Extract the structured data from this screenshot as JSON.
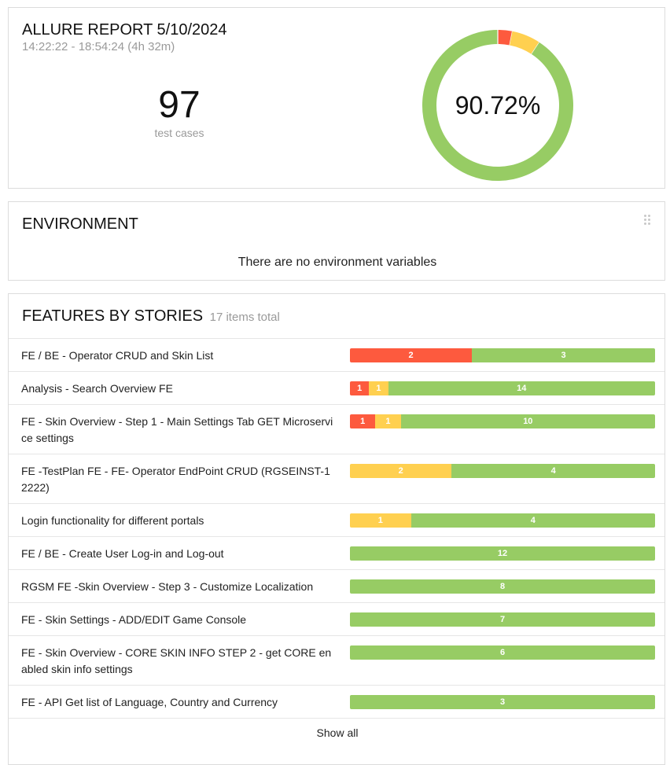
{
  "summary": {
    "title": "ALLURE REPORT 5/10/2024",
    "time_range": "14:22:22 - 18:54:24 (4h 32m)",
    "total": "97",
    "total_label": "test cases",
    "pass_rate": "90.72%",
    "donut": {
      "failed": 3,
      "broken": 6,
      "passed": 88,
      "colors": {
        "failed": "#fd5a3e",
        "broken": "#ffd050",
        "passed": "#97cc64"
      }
    }
  },
  "environment": {
    "title": "ENVIRONMENT",
    "empty_message": "There are no environment variables",
    "handle_icon": "drag-handle-icon"
  },
  "features": {
    "title": "FEATURES BY STORIES",
    "subtitle": "17 items total",
    "show_all_label": "Show all",
    "rows": [
      {
        "label": "FE / BE - Operator CRUD and Skin List",
        "failed": 2,
        "broken": 0,
        "passed": 3
      },
      {
        "label": "Analysis - Search Overview FE",
        "failed": 1,
        "broken": 1,
        "passed": 14
      },
      {
        "label": "FE - Skin Overview - Step 1 - Main Settings Tab GET Microservice settings",
        "failed": 1,
        "broken": 1,
        "passed": 10
      },
      {
        "label": "FE -TestPlan FE - FE- Operator EndPoint CRUD (RGSEINST-12222)",
        "failed": 0,
        "broken": 2,
        "passed": 4
      },
      {
        "label": "Login functionality for different portals",
        "failed": 0,
        "broken": 1,
        "passed": 4
      },
      {
        "label": "FE / BE - Create User Log-in and Log-out",
        "failed": 0,
        "broken": 0,
        "passed": 12
      },
      {
        "label": "RGSM FE -Skin Overview - Step 3 - Customize Localization",
        "failed": 0,
        "broken": 0,
        "passed": 8
      },
      {
        "label": "FE - Skin Settings - ADD/EDIT Game Console",
        "failed": 0,
        "broken": 0,
        "passed": 7
      },
      {
        "label": "FE - Skin Overview - CORE SKIN INFO STEP 2 - get CORE enabled skin info settings",
        "failed": 0,
        "broken": 0,
        "passed": 6
      },
      {
        "label": "FE - API Get list of Language, Country and Currency",
        "failed": 0,
        "broken": 0,
        "passed": 3
      }
    ]
  }
}
